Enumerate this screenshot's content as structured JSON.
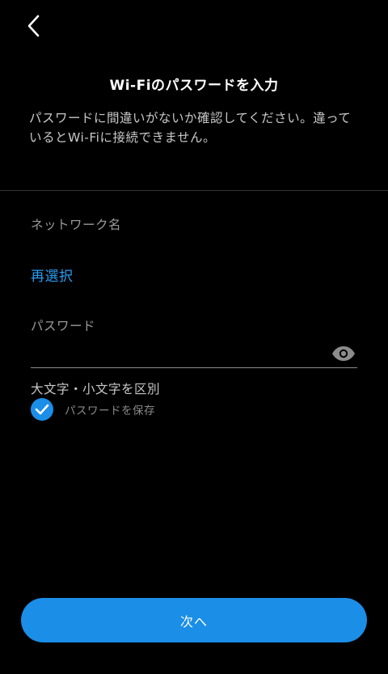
{
  "header": {
    "back_icon": "chevron-left-icon",
    "title": "Wi-Fiのパスワードを入力",
    "subtitle": "パスワードに間違いがないか確認してください。違っているとWi-Fiに接続できません。"
  },
  "network": {
    "label": "ネットワーク名",
    "name": "",
    "reselect_label": "再選択"
  },
  "password": {
    "label": "パスワード",
    "value": "",
    "placeholder": "",
    "visibility_icon": "eye-icon"
  },
  "case_note": "大文字・小文字を区別",
  "save_password": {
    "label": "パスワードを保存",
    "checked": true,
    "icon": "check-icon"
  },
  "next_button": {
    "label": "次へ"
  },
  "colors": {
    "background": "#000000",
    "accent": "#1b8ee8",
    "link": "#2b9bf0"
  }
}
